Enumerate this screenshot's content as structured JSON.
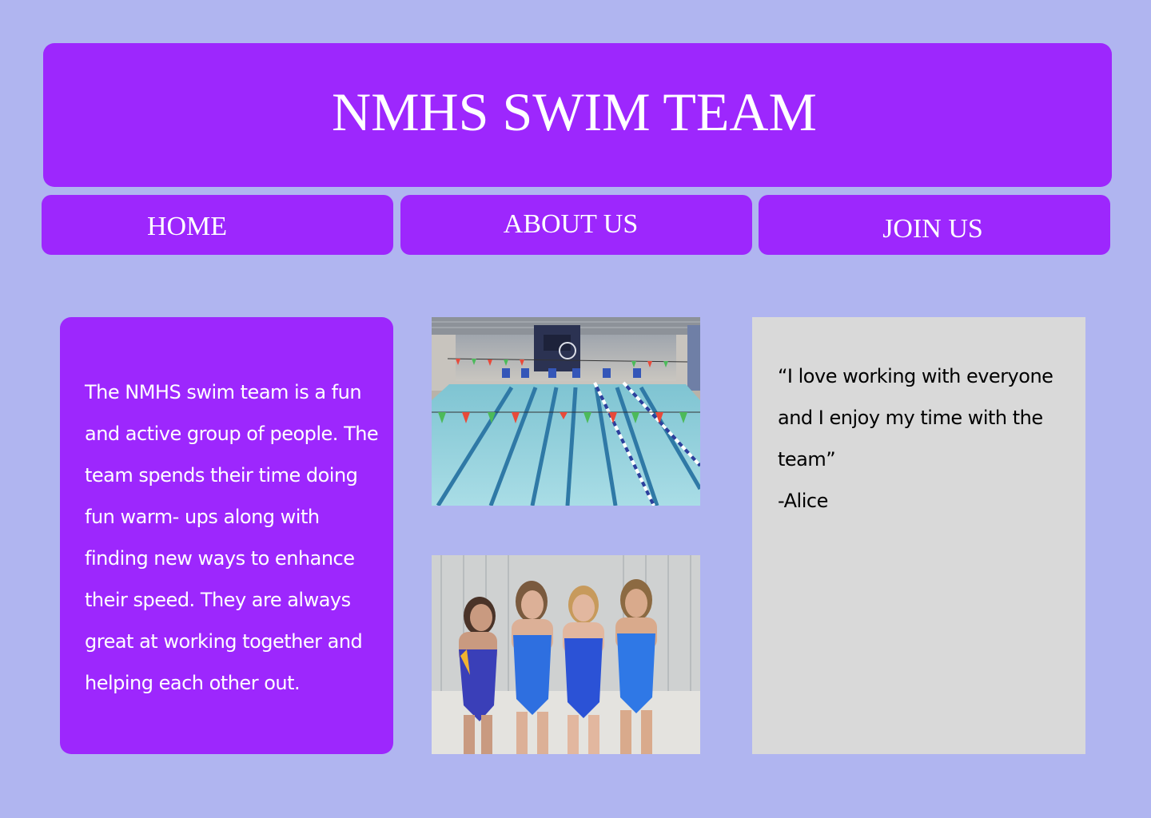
{
  "header": {
    "title": "NMHS SWIM TEAM"
  },
  "nav": {
    "home": "HOME",
    "about": "ABOUT US",
    "join": "JOIN US"
  },
  "about": {
    "text": "The NMHS swim team is a fun and active group of people.  The team spends their time doing fun warm- ups along with finding new ways to enhance their speed. They are always great at working together and helping each other out."
  },
  "quote": {
    "text": "“I love working with everyone and I enjoy my time with the team”",
    "author": "-Alice"
  },
  "colors": {
    "background": "#b0b5f0",
    "primary": "#9d27fd",
    "quote_bg": "#d9d9d9"
  }
}
